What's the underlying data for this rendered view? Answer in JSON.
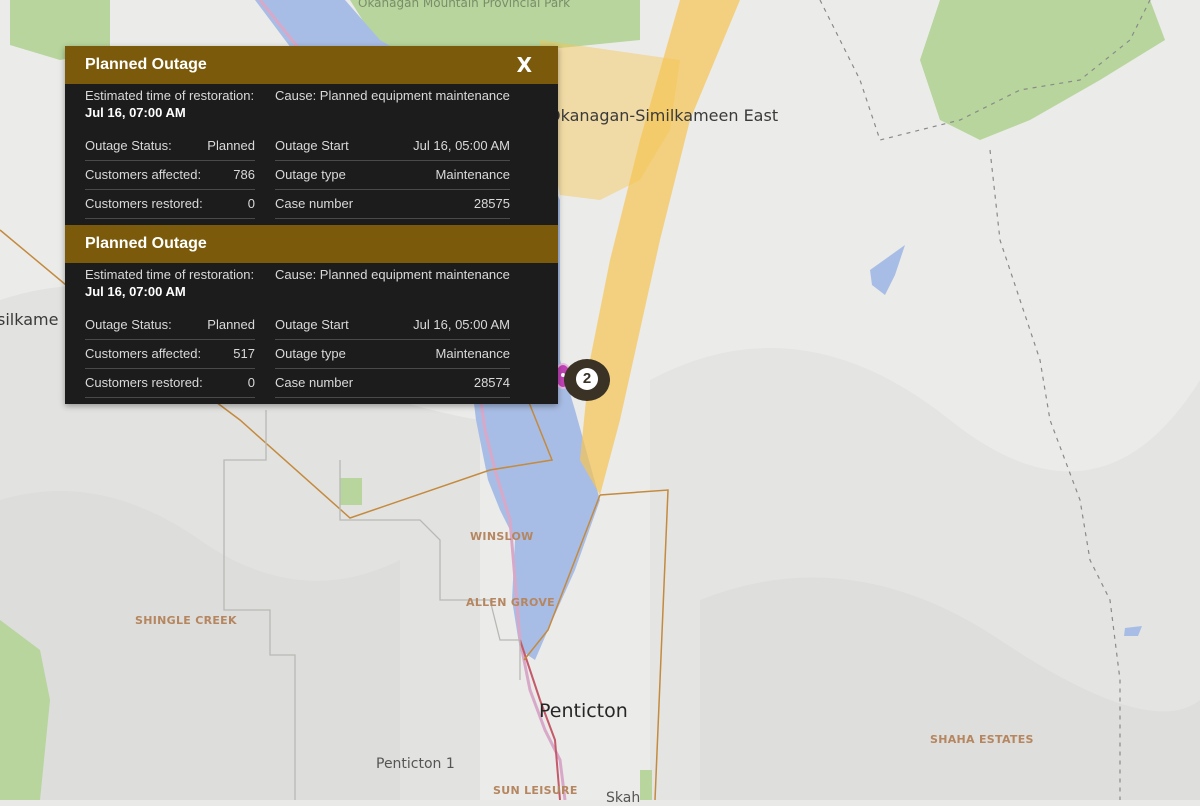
{
  "map": {
    "labels": {
      "park": "Okanagan Mountain Provincial Park",
      "region_east": "Okanagan-Similkameen East",
      "region_west_partial": "silkame",
      "city": "Penticton",
      "district": "Penticton 1",
      "winslow": "WINSLOW",
      "allen_grove": "ALLEN GROVE",
      "shingle_creek": "SHINGLE CREEK",
      "shaha_estates": "SHAHA ESTATES",
      "sun_leisure": "SUN LEISURE",
      "skaha_partial": "Skah"
    },
    "colors": {
      "water": "#a8bde5",
      "park_green": "#b7d59c",
      "outage_area": "#f6c552",
      "boundary": "#c48a3e"
    }
  },
  "marker": {
    "cluster_count": "2",
    "pin_icon": "outage-pin-icon"
  },
  "popup": {
    "close_label": "X",
    "outages": [
      {
        "title": "Planned Outage",
        "eta_label": "Estimated time of restoration:",
        "eta_value": "Jul 16, 07:00 AM",
        "cause": "Cause: Planned equipment maintenance",
        "status_label": "Outage Status:",
        "status_value": "Planned",
        "affected_label": "Customers affected:",
        "affected_value": "786",
        "restored_label": "Customers restored:",
        "restored_value": "0",
        "start_label": "Outage Start",
        "start_value": "Jul 16, 05:00 AM",
        "type_label": "Outage type",
        "type_value": "Maintenance",
        "case_label": "Case number",
        "case_value": "28575"
      },
      {
        "title": "Planned Outage",
        "eta_label": "Estimated time of restoration:",
        "eta_value": "Jul 16, 07:00 AM",
        "cause": "Cause: Planned equipment maintenance",
        "status_label": "Outage Status:",
        "status_value": "Planned",
        "affected_label": "Customers affected:",
        "affected_value": "517",
        "restored_label": "Customers restored:",
        "restored_value": "0",
        "start_label": "Outage Start",
        "start_value": "Jul 16, 05:00 AM",
        "type_label": "Outage type",
        "type_value": "Maintenance",
        "case_label": "Case number",
        "case_value": "28574"
      }
    ]
  }
}
